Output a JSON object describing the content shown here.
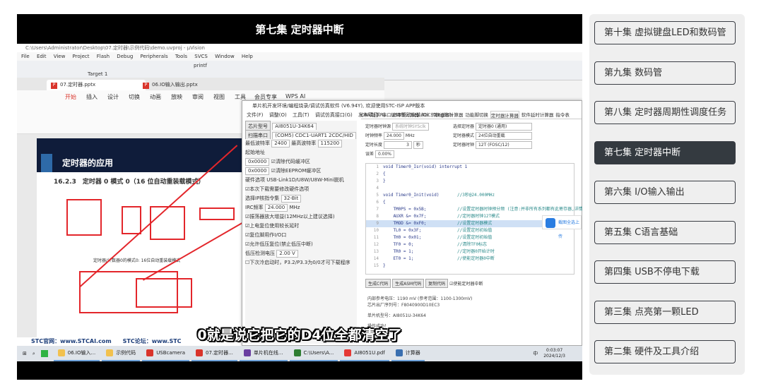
{
  "video": {
    "title": "第七集 定时器中断",
    "subtitle": "0就是说它把它的D4位全都清空了",
    "screen": {
      "uvision_title": "C:\\Users\\Administrator\\Desktop\\07.定时器\\示例代码\\demo.uvproj - µVision",
      "uvision_menu": "File Edit View Project Flash Debug Peripherals Tools SVCS Window Help",
      "uvision_target": "Target 1",
      "uvision_func": "printf",
      "wps_tabs": [
        "07.定时器.pptx",
        "06.IO输入输出.pptx"
      ],
      "ribbon_tabs": [
        "开始",
        "插入",
        "设计",
        "切换",
        "动画",
        "放映",
        "审阅",
        "视图",
        "工具",
        "会员专享",
        "WPS AI"
      ],
      "slide_title": "定时器的应用",
      "slide_subtitle": "16.2.3　定时器 0 模式 0（16 位自动重装载模式）",
      "slide_caption": "定时器/计数器0的模式0: 16位自动重装载模式",
      "slide_footer": "STC官网：www.STCAI.com　　STC论坛：www.STC",
      "isp_title": "单片机开发环境/编程烧录/调试仿真软件 (V6.94Y), 欢迎使用STC-ISP APP版本",
      "isp_menu": "文件(F) 调整(O) 工具(T) 调试仿真接口(G) 发布项目(R) USB驱动安装(D) English",
      "isp_left": [
        [
          "芯片型号",
          "AI8051U-34K64"
        ],
        [
          "扫描串口",
          "(COM5) CDC1-UART1 2CDC/HID"
        ],
        [
          "最低波特率",
          "2400",
          "最高波特率",
          "115200"
        ],
        [
          "起始地址",
          "0x0000",
          "清除代码缓冲区"
        ],
        [
          "",
          "0x0000",
          "清除EEPROM缓冲区"
        ],
        [
          "硬件选项",
          "USB-Link1D/U8W/U8W-Mini脱机"
        ],
        [
          "本次下载需要修改硬件选项"
        ],
        [
          "选择IP核指令集",
          "32-Bit"
        ],
        [
          "IRC频率",
          "24.000",
          "MHz"
        ],
        [
          "振荡器放大增益(12MHz以上建议选择)"
        ],
        [
          "上电复位使用较长延时"
        ],
        [
          "复位脚用作I/O口"
        ],
        [
          "允许低压复位(禁止低压中断)"
        ],
        [
          "低压检测电压",
          "2.00 V"
        ],
        [
          "下次冷启动时，P3.2/P3.3为0/0才可下载程序"
        ]
      ],
      "isp_tabs": [
        "CAN助手",
        "串口波特率计算器",
        "ADC转换速度计算器",
        "功能脚切换",
        "定时器计算器",
        "软件延时计算器",
        "指令表"
      ],
      "timer_fields": {
        "clock_src_label": "定时器时钟源",
        "clock_src": "系统时钟SYSclk",
        "freq_label": "时钟频率",
        "freq": "24.000",
        "freq_unit": "MHz",
        "len_label": "定时长度",
        "len": "3",
        "len_unit": "秒",
        "err_label": "误差",
        "err": "0.00%",
        "sel_label": "选择定时器",
        "sel": "定时器0 (通用)",
        "mode_label": "定时器模式",
        "mode": "24位自动重载",
        "tclk_label": "定时器时钟",
        "tclk": "12T (FOSC/12)"
      },
      "code": [
        [
          "1",
          "void Timer0_Isr(void) interrupt 1",
          ""
        ],
        [
          "2",
          "{",
          ""
        ],
        [
          "3",
          "}",
          ""
        ],
        [
          "4",
          "",
          ""
        ],
        [
          "5",
          "void Timer0_Init(void)",
          "//3秒@24.000MHz"
        ],
        [
          "6",
          "{",
          ""
        ],
        [
          "7",
          "    TM0PS = 0x5B;",
          "//设置定时器时钟预分频 (注意:并非所有系列都有此寄存器,详情"
        ],
        [
          "8",
          "    AUXR &= 0x7F;",
          "//定时器时钟12T模式"
        ],
        [
          "9",
          "    TMOD &= 0xF0;",
          "//设置定时器模式"
        ],
        [
          "10",
          "    TL0 = 0x3F;",
          "//设置定时初始值"
        ],
        [
          "11",
          "    TH0 = 0x01;",
          "//设置定时初始值"
        ],
        [
          "12",
          "    TF0 = 0;",
          "//清除TF0标志"
        ],
        [
          "13",
          "    TR0 = 1;",
          "//定时器0开始计时"
        ],
        [
          "14",
          "    ET0 = 1;",
          "//使能定时器0中断"
        ],
        [
          "15",
          "}",
          ""
        ]
      ],
      "code_buttons": [
        "生成C代码",
        "生成ASM代码",
        "复制代码"
      ],
      "enable_interrupt": "使能定时器中断",
      "float_button": "截图全选上传",
      "output_lines": [
        "内部参考电压：1190 mV (参考范围：1100-1300mV)",
        "芯片出厂序列号：F8040900D10EC3",
        "单片机型号：AI8051U-34K64",
        "操作成功！"
      ]
    },
    "taskbar": {
      "items": [
        {
          "label": "06.IO输入...",
          "color": "#f2c14e"
        },
        {
          "label": "示例代码",
          "color": "#f2c14e"
        },
        {
          "label": "USBcamera",
          "color": "#d9342b"
        },
        {
          "label": "07.定时器...",
          "color": "#d9342b"
        },
        {
          "label": "单片机在线...",
          "color": "#6a3fa0"
        },
        {
          "label": "C:\\Users\\A...",
          "color": "#2e7d32"
        },
        {
          "label": "AI8051U.pdf",
          "color": "#e53935"
        },
        {
          "label": "计算器",
          "color": "#3a6fb0"
        }
      ],
      "ime": "中",
      "time": "0:03:07",
      "date": "2024/12/3"
    }
  },
  "playlist": {
    "active_index": 3,
    "episodes": [
      "第十集 虚拟键盘LED和数码管",
      "第九集 数码管",
      "第八集 定时器周期性调度任务",
      "第七集 定时器中断",
      "第六集 I/O输入输出",
      "第五集 C语言基础",
      "第四集 USB不停电下载",
      "第三集 点亮第一颗LED",
      "第二集 硬件及工具介绍"
    ]
  }
}
